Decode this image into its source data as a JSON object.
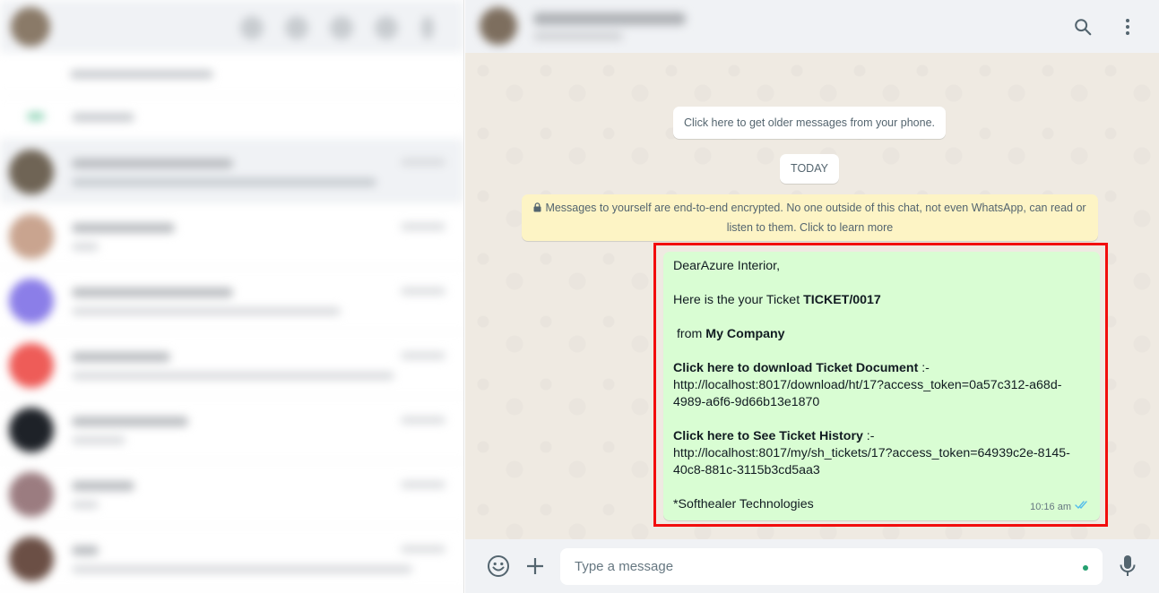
{
  "chat_header": {
    "search_icon": "search-icon",
    "menu_icon": "kebab-menu-icon"
  },
  "conversation": {
    "older_messages_link": "Click here to get older messages from your phone.",
    "date_divider": "TODAY",
    "encryption_notice": "Messages to yourself are end-to-end encrypted. No one outside of this chat, not even WhatsApp, can read or listen to them. Click to learn more",
    "message": {
      "greeting": "DearAzure Interior,",
      "ticket_prefix": "Here is the your Ticket ",
      "ticket_number": "TICKET/0017",
      "from_prefix": " from ",
      "company": "My Company",
      "download_label": "Click here to download Ticket Document",
      "download_sep": " :-",
      "download_url": "http://localhost:8017/download/ht/17?access_token=0a57c312-a68d-4989-a6f6-9d66b13e1870",
      "history_label": "Click here to See Ticket History",
      "history_sep": " :-",
      "history_url": "http://localhost:8017/my/sh_tickets/17?access_token=64939c2e-8145-40c8-881c-3115b3cd5aa3",
      "signature": "*Softhealer Technologies",
      "time": "10:16 am",
      "status_icon": "double-check-icon",
      "status_color": "#53bdeb"
    }
  },
  "composer": {
    "placeholder": "Type a message",
    "emoji_icon": "emoji-icon",
    "attach_icon": "plus-icon",
    "mic_icon": "microphone-icon"
  },
  "colors": {
    "outgoing_bubble": "#d9fdd3",
    "encryption_bg": "#fdf4c5",
    "highlight_border": "#f20d0d",
    "chat_bg": "#efeae2"
  }
}
